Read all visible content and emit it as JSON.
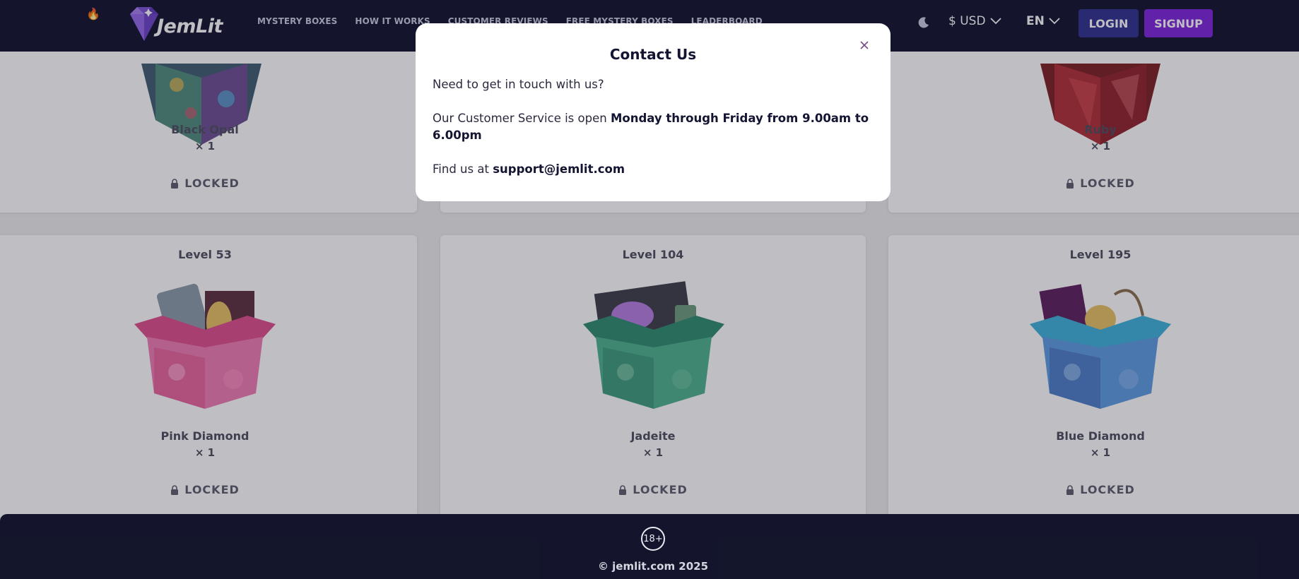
{
  "brand": {
    "name": "JemLit"
  },
  "nav": {
    "links": [
      "MYSTERY BOXES",
      "HOW IT WORKS",
      "CUSTOMER REVIEWS",
      "FREE MYSTERY BOXES",
      "LEADERBOARD"
    ],
    "currency": "$ USD",
    "language": "EN",
    "login_label": "LOGIN",
    "signup_label": "SIGNUP"
  },
  "cards_top": [
    {
      "name": "Black Opal",
      "qty": "× 1",
      "status": "LOCKED"
    },
    {
      "name": "Ruby",
      "qty": "× 1",
      "status": "LOCKED"
    }
  ],
  "cards_bottom": [
    {
      "level": "Level 53",
      "name": "Pink Diamond",
      "qty": "× 1",
      "status": "LOCKED"
    },
    {
      "level": "Level 104",
      "name": "Jadeite",
      "qty": "× 1",
      "status": "LOCKED"
    },
    {
      "level": "Level 195",
      "name": "Blue Diamond",
      "qty": "× 1",
      "status": "LOCKED"
    }
  ],
  "modal": {
    "title": "Contact Us",
    "intro": "Need to get in touch with us?",
    "hours_prefix": "Our Customer Service is open ",
    "hours_bold": "Monday through Friday from 9.00am to 6.00pm",
    "find_prefix": "Find us at ",
    "email": "support@jemlit.com"
  },
  "footer": {
    "age_badge": "18+",
    "copyright": "© jemlit.com 2025"
  },
  "colors": {
    "nav_bg": "#0c0e27",
    "login_bg": "#2a2c8a",
    "signup_bg": "#7a1fd8"
  }
}
